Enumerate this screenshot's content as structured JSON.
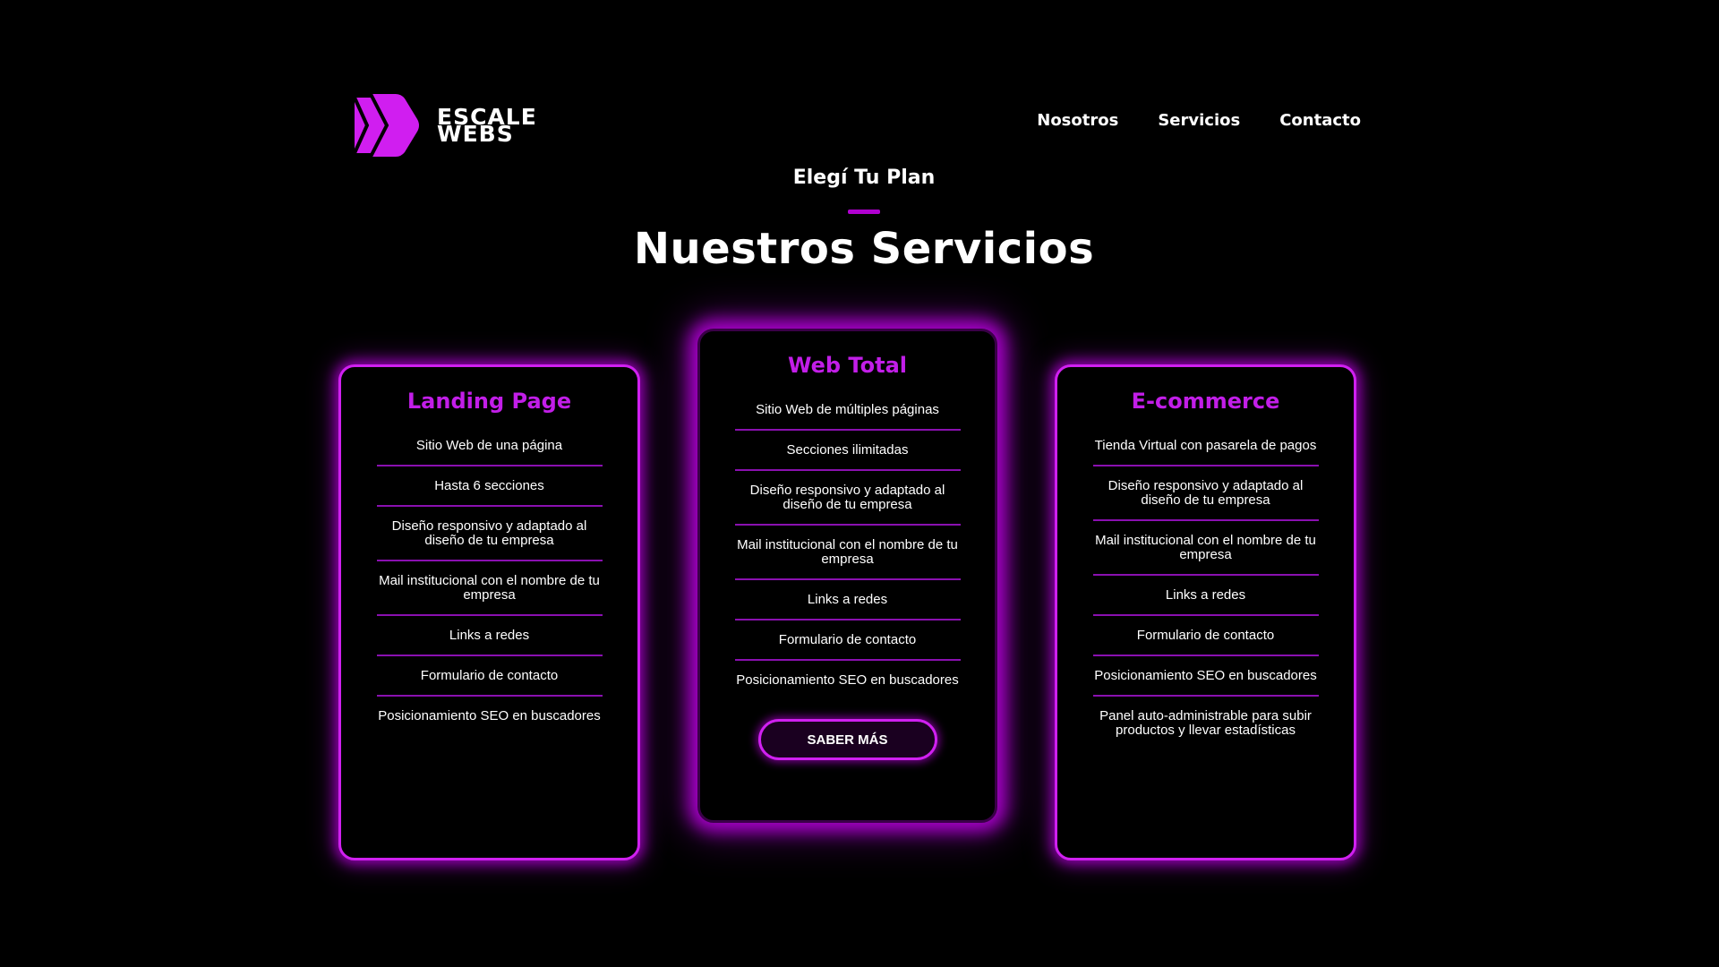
{
  "brand": {
    "line1": "ESCALE",
    "line2": "WEBS",
    "accent_color": "#c21ee8"
  },
  "nav": {
    "items": [
      "Nosotros",
      "Servicios",
      "Contacto"
    ]
  },
  "section": {
    "eyebrow": "Elegí Tu Plan",
    "title": "Nuestros Servicios"
  },
  "plans": [
    {
      "title": "Landing Page",
      "features": [
        "Sitio Web de una página",
        "Hasta 6 secciones",
        "Diseño responsivo y adaptado al diseño de tu empresa",
        "Mail institucional con el nombre de tu empresa",
        "Links a redes",
        "Formulario de contacto",
        "Posicionamiento SEO en buscadores"
      ]
    },
    {
      "title": "Web Total",
      "features": [
        "Sitio Web de múltiples páginas",
        "Secciones ilimitadas",
        "Diseño responsivo y adaptado al diseño de tu empresa",
        "Mail institucional con el nombre de tu empresa",
        "Links a redes",
        "Formulario de contacto",
        "Posicionamiento SEO en buscadores"
      ],
      "cta_label": "SABER MÁS"
    },
    {
      "title": "E-commerce",
      "features": [
        "Tienda Virtual con pasarela de pagos",
        "Diseño responsivo y adaptado al diseño de tu empresa",
        "Mail institucional con el nombre de tu empresa",
        "Links a redes",
        "Formulario de contacto",
        "Posicionamiento SEO en buscadores",
        "Panel auto-administrable para subir productos y llevar estadísticas"
      ]
    }
  ]
}
